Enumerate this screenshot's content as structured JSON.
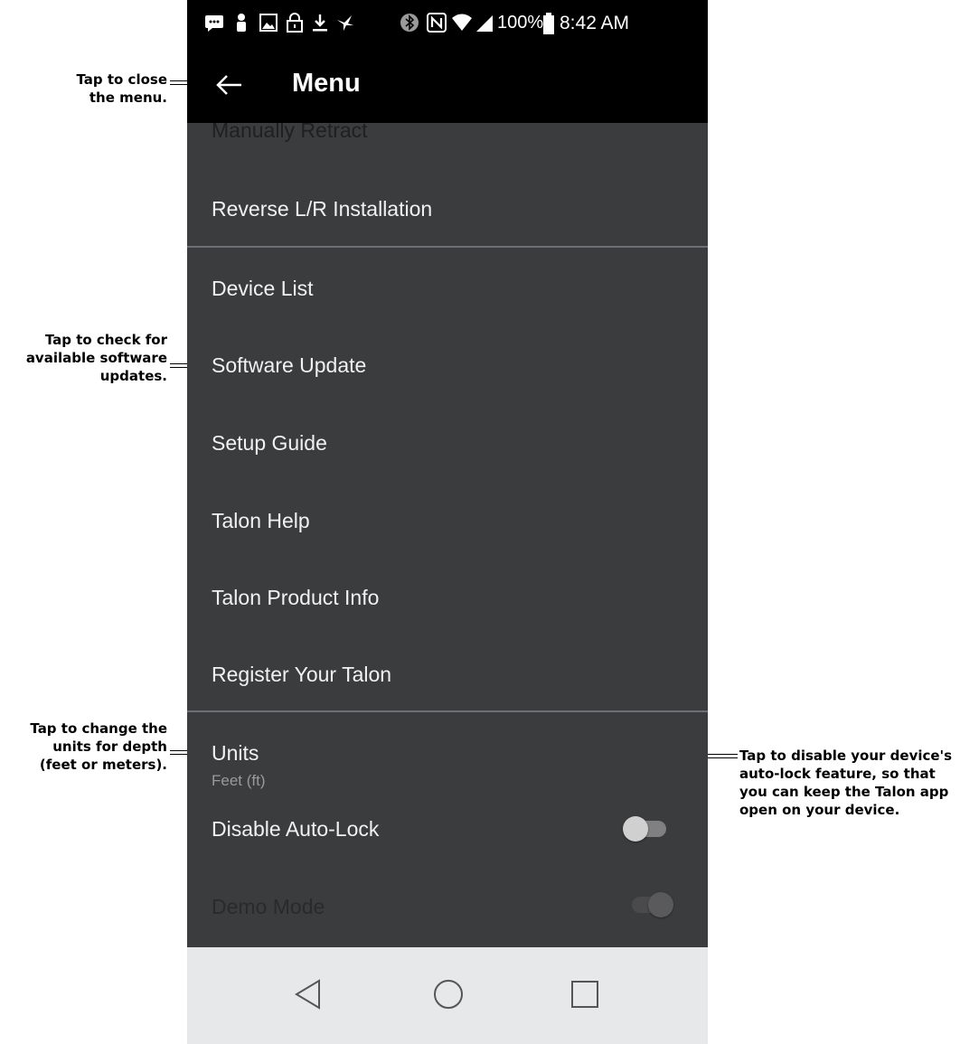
{
  "status_bar": {
    "battery": "100%",
    "time": "8:42 AM"
  },
  "app_bar": {
    "title": "Menu"
  },
  "menu": {
    "partial_item": "Manually Retract",
    "items": [
      "Reverse L/R Installation",
      "Device List",
      "Software Update",
      "Setup Guide",
      "Talon Help",
      "Talon Product Info",
      "Register Your Talon"
    ],
    "units": {
      "label": "Units",
      "value": "Feet (ft)"
    },
    "disable_auto_lock": {
      "label": "Disable Auto-Lock",
      "on": false
    },
    "demo_mode": {
      "label": "Demo Mode",
      "on": true
    }
  },
  "callouts": {
    "close_menu": [
      "Tap to close",
      "the menu."
    ],
    "software_update": [
      "Tap to check for",
      "available software",
      "updates."
    ],
    "units": [
      "Tap to change the",
      "units for depth",
      "(feet or meters)."
    ],
    "auto_lock": [
      "Tap to disable your device's",
      "auto-lock feature, so that",
      "you can keep the Talon app",
      "open on your device."
    ]
  },
  "colors": {
    "menu_background": "#3b3c3e",
    "app_bar": "#000000",
    "nav_bar": "#e7e8ea",
    "toggle_off_knob": "#d0d0d0",
    "toggle_on_knob": "#5a5a5c"
  },
  "icons": [
    "message-icon",
    "person-icon",
    "image-icon",
    "lock-icon",
    "download-icon",
    "bird-icon",
    "bluetooth-icon",
    "nfc-icon",
    "wifi-icon",
    "signal-icon",
    "battery-icon",
    "back-arrow-icon",
    "nav-back-icon",
    "nav-home-icon",
    "nav-recents-icon"
  ]
}
